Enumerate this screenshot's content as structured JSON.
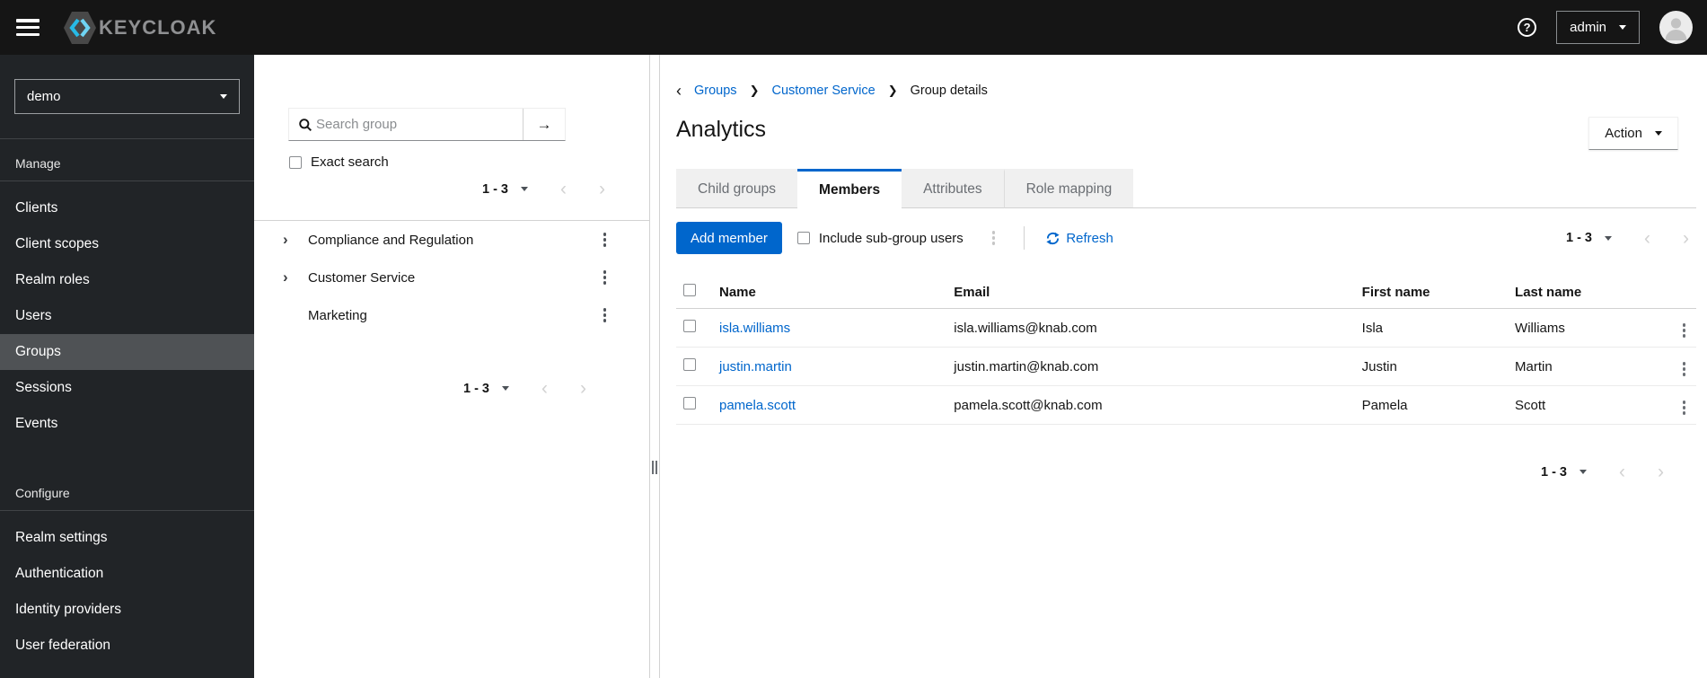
{
  "topbar": {
    "brand": "KEYCLOAK",
    "user_menu": {
      "label": "admin"
    },
    "icons": {
      "menu": "hamburger-icon",
      "help": "question-circle-icon",
      "avatar": "user-avatar"
    }
  },
  "sidebar": {
    "realm_selector": {
      "value": "demo"
    },
    "active_item": "Groups",
    "sections": [
      {
        "label": "Manage",
        "items": [
          "Clients",
          "Client scopes",
          "Realm roles",
          "Users",
          "Groups",
          "Sessions",
          "Events"
        ]
      },
      {
        "label": "Configure",
        "items": [
          "Realm settings",
          "Authentication",
          "Identity providers",
          "User federation"
        ]
      }
    ]
  },
  "groups_panel": {
    "search": {
      "placeholder": "Search group"
    },
    "exact_search_label": "Exact search",
    "pagination_top": "1 - 3",
    "pagination_bottom": "1 - 3",
    "tree": [
      {
        "label": "Compliance and Regulation",
        "expandable": true
      },
      {
        "label": "Customer Service",
        "expandable": true
      },
      {
        "label": "Marketing",
        "expandable": false
      }
    ]
  },
  "main": {
    "breadcrumb": {
      "items": [
        "Groups",
        "Customer Service",
        "Group details"
      ]
    },
    "title": "Analytics",
    "action_button_label": "Action",
    "active_tab": "Members",
    "tabs": [
      {
        "label": "Child groups"
      },
      {
        "label": "Members"
      },
      {
        "label": "Attributes"
      },
      {
        "label": "Role mapping"
      }
    ],
    "toolbar": {
      "add_member_label": "Add member",
      "include_subgroup_label": "Include sub-group users",
      "refresh_label": "Refresh",
      "pagination": "1 - 3"
    },
    "table": {
      "headers": [
        "Name",
        "Email",
        "First name",
        "Last name"
      ],
      "rows": [
        {
          "username": "isla.williams",
          "email": "isla.williams@knab.com",
          "first_name": "Isla",
          "last_name": "Williams"
        },
        {
          "username": "justin.martin",
          "email": "justin.martin@knab.com",
          "first_name": "Justin",
          "last_name": "Martin"
        },
        {
          "username": "pamela.scott",
          "email": "pamela.scott@knab.com",
          "first_name": "Pamela",
          "last_name": "Scott"
        }
      ],
      "pagination_bottom": "1 - 3"
    }
  },
  "colors": {
    "primary": "#0066cc",
    "link": "#0066cc",
    "topbar_bg": "#151515",
    "sidebar_bg": "#212427",
    "sidebar_active_bg": "#4f5255",
    "tab_inactive_bg": "#f0f0f0",
    "border": "#d2d2d2"
  }
}
